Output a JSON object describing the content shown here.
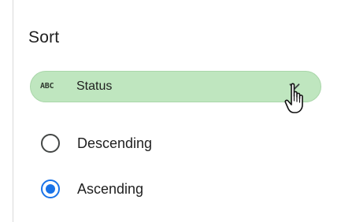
{
  "sort_panel": {
    "title": "Sort",
    "field_chip": {
      "type_icon": "abc-type-icon",
      "type_icon_text": "ABC",
      "label": "Status",
      "caret_icon": "chevron-down-icon",
      "background_color": "#bfe6bf"
    },
    "order_options": [
      {
        "label": "Descending",
        "selected": false
      },
      {
        "label": "Ascending",
        "selected": true
      }
    ],
    "accent_color": "#1a73e8"
  },
  "cursor": {
    "icon": "hand-pointer-icon"
  }
}
